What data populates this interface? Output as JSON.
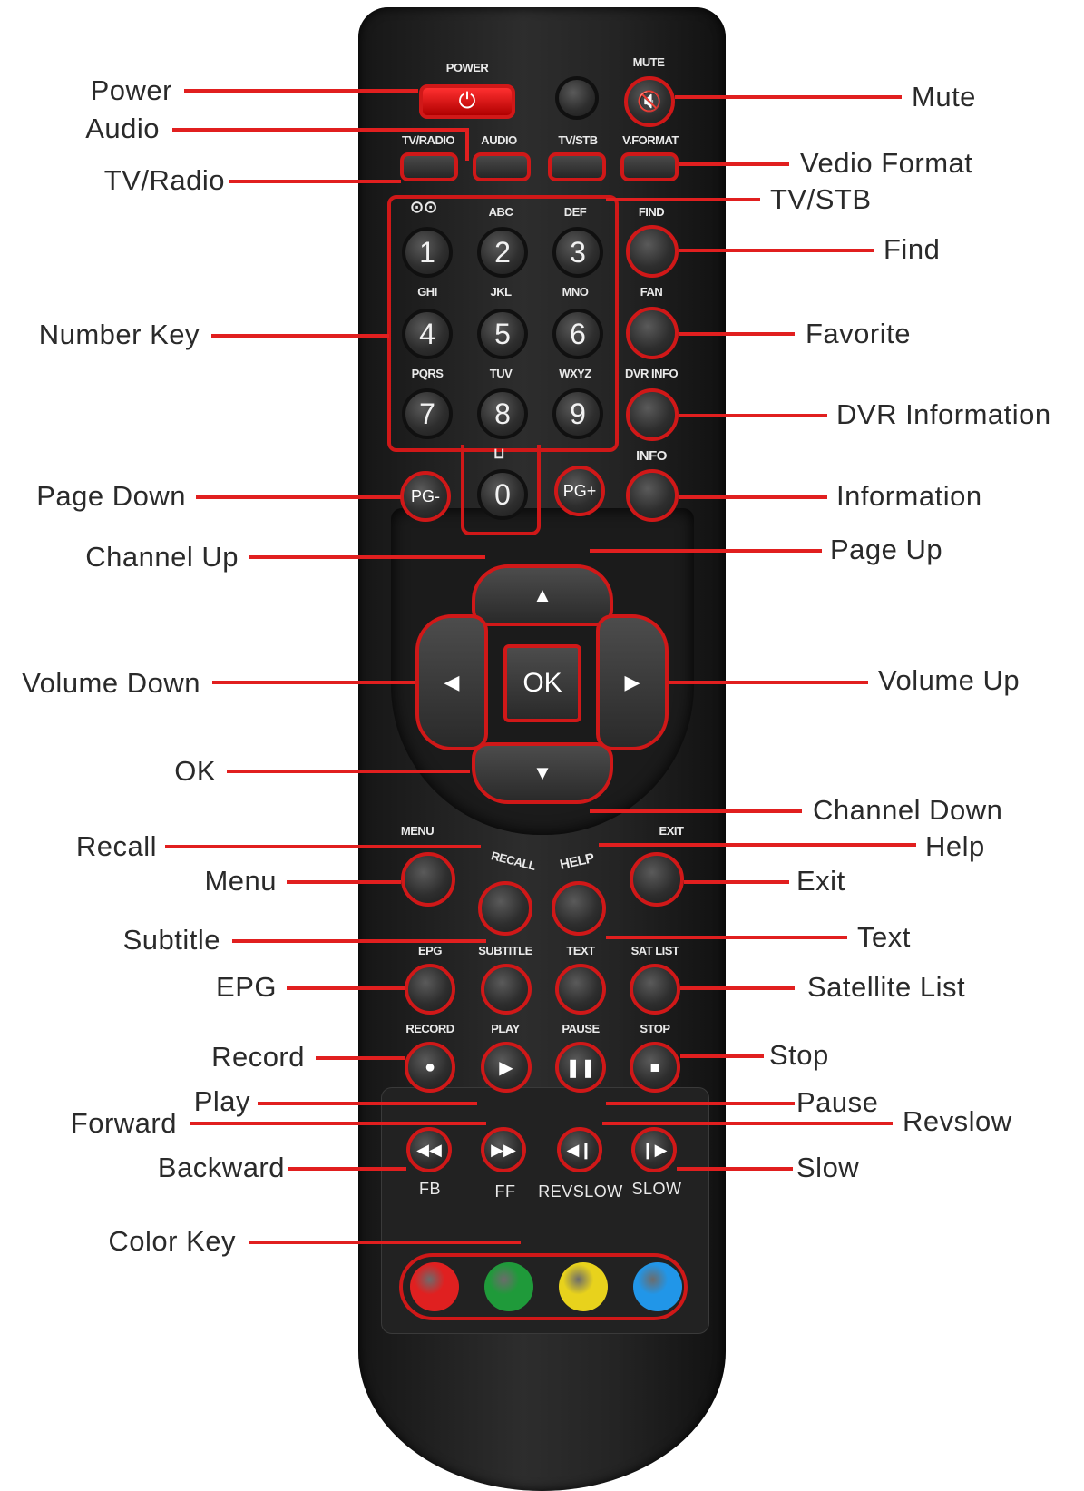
{
  "remote": {
    "top_labels": {
      "power": "POWER",
      "mute": "MUTE"
    },
    "row_labels": {
      "tv_radio": "TV/RADIO",
      "audio": "AUDIO",
      "tv_stb": "TV/STB",
      "v_format": "V.FORMAT"
    },
    "numbers": [
      {
        "digit": "1",
        "letters": ""
      },
      {
        "digit": "2",
        "letters": "ABC"
      },
      {
        "digit": "3",
        "letters": "DEF"
      },
      {
        "digit": "4",
        "letters": "GHI"
      },
      {
        "digit": "5",
        "letters": "JKL"
      },
      {
        "digit": "6",
        "letters": "MNO"
      },
      {
        "digit": "7",
        "letters": "PQRS"
      },
      {
        "digit": "8",
        "letters": "TUV"
      },
      {
        "digit": "9",
        "letters": "WXYZ"
      },
      {
        "digit": "0",
        "letters": ""
      }
    ],
    "side_labels": {
      "find": "FIND",
      "fan": "FAN",
      "dvr_info": "DVR INFO",
      "info": "INFO"
    },
    "pg_minus": "PG-",
    "pg_plus": "PG+",
    "ok": "OK",
    "func_labels": {
      "menu": "MENU",
      "exit": "EXIT",
      "recall": "RECALL",
      "help": "HELP"
    },
    "row2_labels": {
      "epg": "EPG",
      "subtitle": "SUBTITLE",
      "text": "TEXT",
      "sat_list": "SAT LIST"
    },
    "transport_labels": {
      "record": "RECORD",
      "play": "PLAY",
      "pause": "PAUSE",
      "stop": "STOP"
    },
    "speed_labels": {
      "fb": "FB",
      "ff": "FF",
      "revslow": "REVSLOW",
      "slow": "SLOW"
    },
    "color_keys": [
      "#e02020",
      "#1f9a3a",
      "#e8d21c",
      "#2196e8"
    ]
  },
  "callouts": {
    "power": "Power",
    "audio": "Audio",
    "tv_radio": "TV/Radio",
    "number_key": "Number Key",
    "page_down": "Page Down",
    "channel_up": "Channel Up",
    "volume_down": "Volume Down",
    "ok": "OK",
    "recall": "Recall",
    "menu": "Menu",
    "subtitle": "Subtitle",
    "epg": "EPG",
    "record": "Record",
    "play": "Play",
    "forward": "Forward",
    "backward": "Backward",
    "color_key": "Color Key",
    "mute": "Mute",
    "vedio_format": "Vedio Format",
    "tv_stb": "TV/STB",
    "find": "Find",
    "favorite": "Favorite",
    "dvr_information": "DVR Information",
    "information": "Information",
    "page_up": "Page Up",
    "volume_up": "Volume Up",
    "channel_down": "Channel Down",
    "help": "Help",
    "exit": "Exit",
    "text": "Text",
    "satellite_list": "Satellite List",
    "stop": "Stop",
    "pause": "Pause",
    "revslow": "Revslow",
    "slow": "Slow"
  }
}
